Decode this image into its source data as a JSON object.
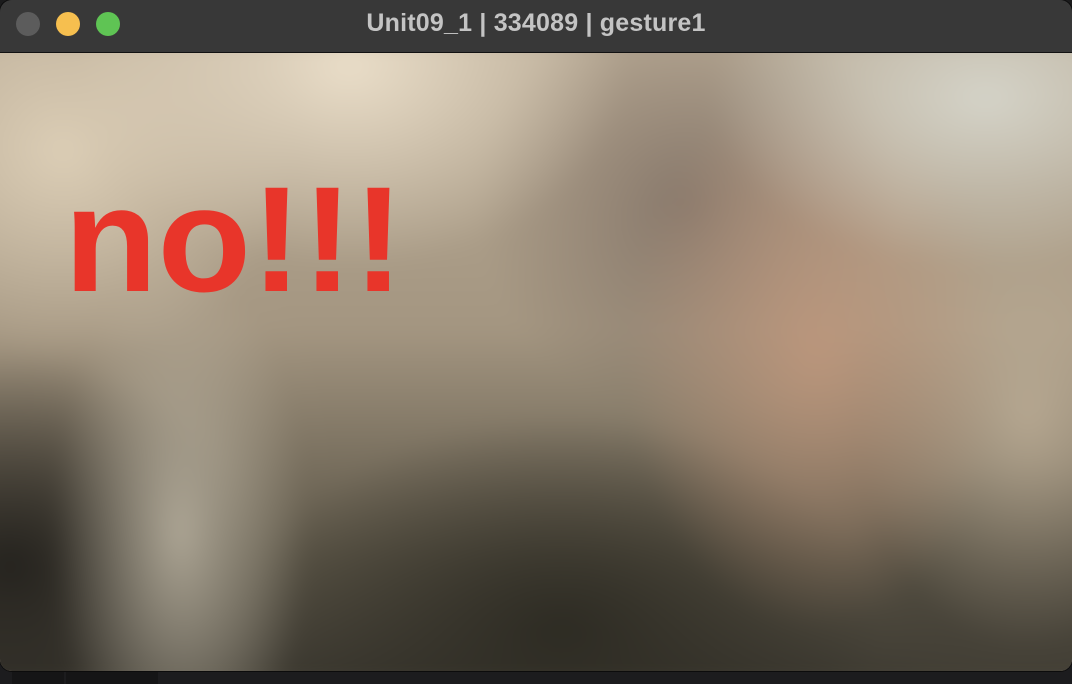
{
  "window": {
    "title": "Unit09_1 | 334089 | gesture1",
    "controls": {
      "close": "close-icon",
      "minimize": "minimize-icon",
      "zoom": "zoom-icon"
    }
  },
  "video": {
    "overlay_text": "no!!!",
    "overlay_color": "#e8352a"
  }
}
